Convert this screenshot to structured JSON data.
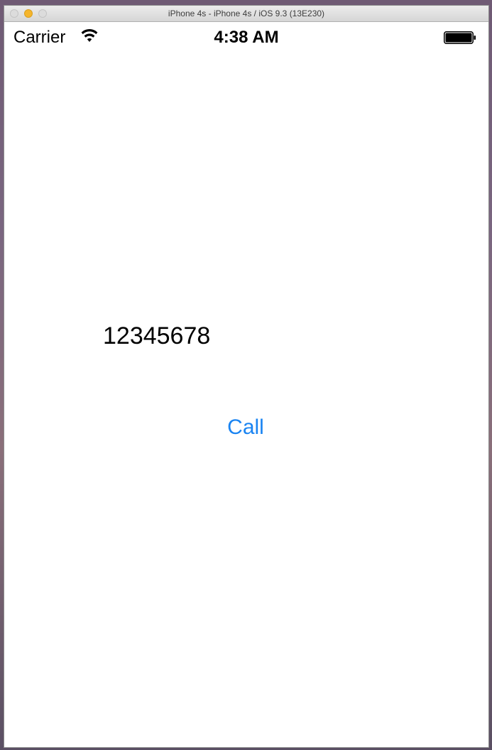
{
  "window": {
    "title": "iPhone 4s - iPhone 4s / iOS 9.3 (13E230)"
  },
  "statusbar": {
    "carrier": "Carrier",
    "time": "4:38 AM",
    "wifi_icon": "wifi-icon",
    "battery_icon": "battery-icon"
  },
  "content": {
    "number": "12345678",
    "call_label": "Call"
  },
  "colors": {
    "accent": "#1a84f2",
    "traffic_minimize": "#f5b52c"
  }
}
